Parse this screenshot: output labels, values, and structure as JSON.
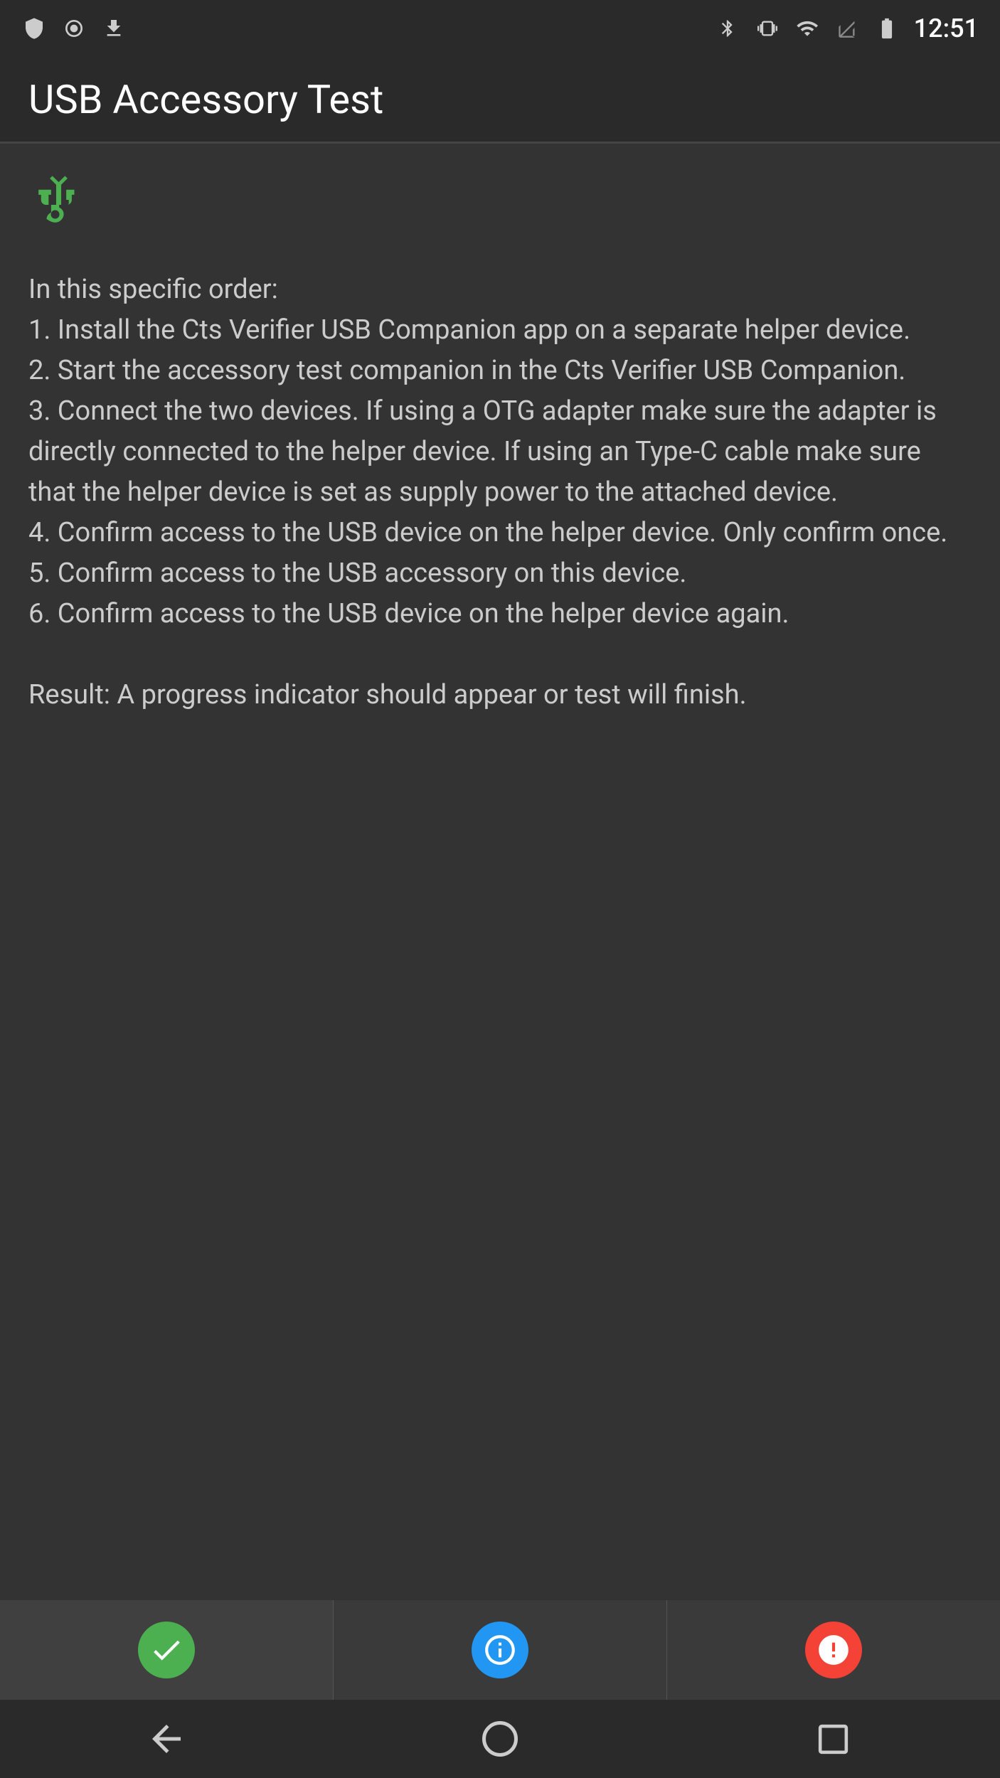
{
  "statusBar": {
    "time": "12:51",
    "leftIcons": [
      "shield",
      "record",
      "download"
    ],
    "rightIcons": [
      "bluetooth",
      "vibrate",
      "wifi",
      "signal",
      "battery"
    ]
  },
  "appBar": {
    "title": "USB Accessory Test"
  },
  "main": {
    "usbIconLabel": "usb-symbol",
    "instructions": "In this specific order:\n1. Install the Cts Verifier USB Companion app on a separate helper device.\n2. Start the accessory test companion in the Cts Verifier USB Companion.\n3. Connect the two devices. If using a OTG adapter make sure the adapter is directly connected to the helper device. If using an Type-C cable make sure that the helper device is set as supply power to the attached device.\n4. Confirm access to the USB device on the helper device. Only confirm once.\n5. Confirm access to the USB accessory on this device.\n6. Confirm access to the USB device on the helper device again.\n\nResult: A progress indicator should appear or test will finish."
  },
  "actionBar": {
    "passButton": "pass-button",
    "infoButton": "info-button",
    "failButton": "fail-button"
  },
  "navBar": {
    "backButton": "back-button",
    "homeButton": "home-button",
    "recentsButton": "recents-button"
  }
}
